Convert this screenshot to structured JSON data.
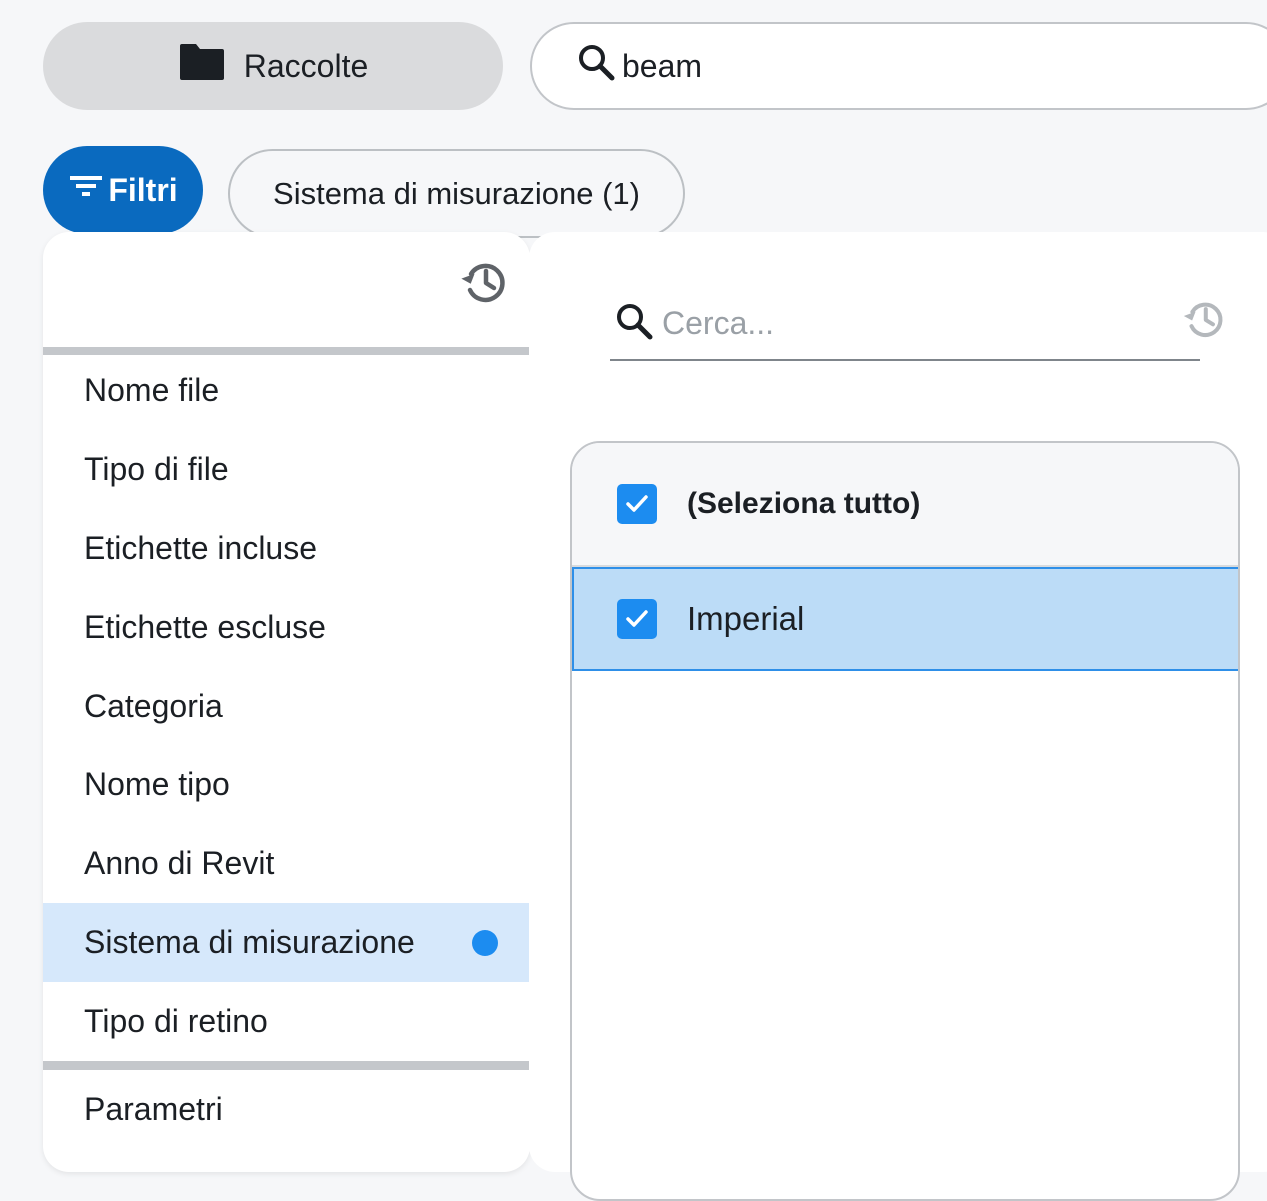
{
  "toolbar": {
    "collections_label": "Raccolte",
    "search_value": "beam",
    "filters_label": "Filtri",
    "active_filter_chip": "Sistema di misurazione (1)"
  },
  "filter_menu": {
    "items": [
      {
        "label": "Nome file"
      },
      {
        "label": "Tipo di file"
      },
      {
        "label": "Etichette incluse"
      },
      {
        "label": "Etichette escluse"
      },
      {
        "label": "Categoria"
      },
      {
        "label": "Nome tipo"
      },
      {
        "label": "Anno di Revit"
      },
      {
        "label": "Sistema di misurazione",
        "active": true,
        "has_indicator": true
      },
      {
        "label": "Tipo di retino"
      }
    ],
    "footer_item": "Parametri"
  },
  "value_panel": {
    "search_placeholder": "Cerca...",
    "select_all_label": "(Seleziona tutto)",
    "select_all_checked": true,
    "options": [
      {
        "label": "Imperial",
        "checked": true,
        "highlighted": true
      }
    ]
  },
  "colors": {
    "accent": "#0a6abf",
    "checkbox": "#1c8cf0",
    "active_item_bg": "#d6e8fb",
    "selected_row_bg": "#bcdcf7"
  },
  "icons": [
    "folder-icon",
    "search-icon",
    "filter-icon",
    "history-icon",
    "check-icon",
    "active-dot"
  ]
}
